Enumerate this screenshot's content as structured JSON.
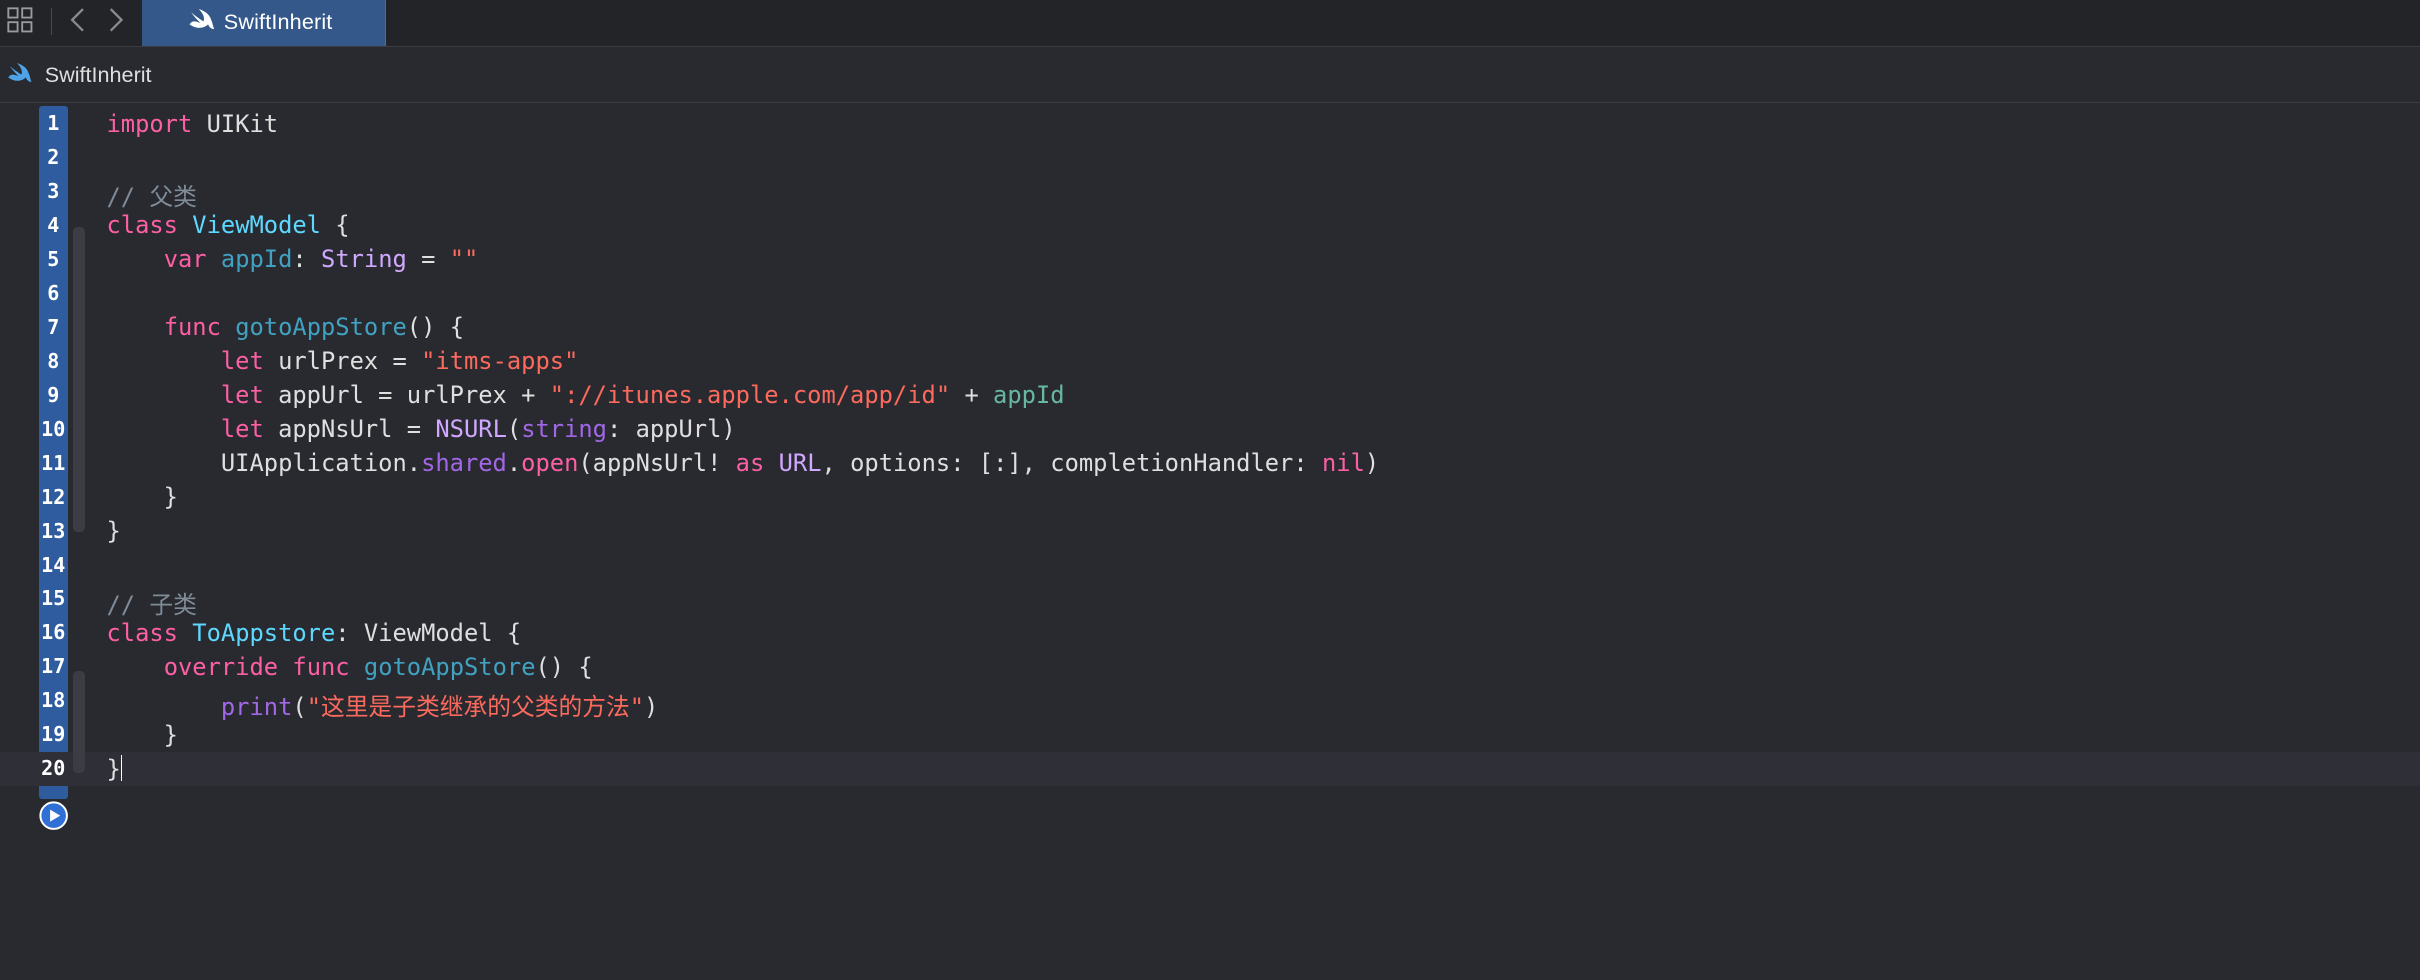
{
  "tabbar": {
    "active_tab": {
      "label": "SwiftInherit",
      "icon": "swift-icon"
    },
    "icons": {
      "grid": "grid-icon",
      "back": "chevron-left-icon",
      "forward": "chevron-right-icon"
    }
  },
  "breadcrumb": {
    "label": "SwiftInherit",
    "icon": "swift-icon"
  },
  "colors": {
    "keyword": "#fc5fa3",
    "comment": "#7f8c98",
    "string": "#fc6a5d",
    "type_decl": "#5dd8ff",
    "system_type": "#d0a8ff",
    "method_decl": "#41a1c0",
    "project_member": "#67b7a4",
    "system_member": "#a167e6",
    "plain": "#dfdfe0",
    "gutter": "#2e5c9e",
    "background": "#292a30"
  },
  "code": {
    "lines": [
      {
        "number": "1",
        "tokens": [
          {
            "t": "import",
            "c": "keyword"
          },
          {
            "t": " UIKit",
            "c": "plain"
          }
        ]
      },
      {
        "number": "2",
        "tokens": []
      },
      {
        "number": "3",
        "tokens": [
          {
            "t": "// 父类",
            "c": "comment"
          }
        ]
      },
      {
        "number": "4",
        "tokens": [
          {
            "t": "class",
            "c": "keyword"
          },
          {
            "t": " ",
            "c": "plain"
          },
          {
            "t": "ViewModel",
            "c": "type_decl"
          },
          {
            "t": " {",
            "c": "plain"
          }
        ]
      },
      {
        "number": "5",
        "tokens": [
          {
            "t": "    ",
            "c": "plain"
          },
          {
            "t": "var",
            "c": "keyword"
          },
          {
            "t": " ",
            "c": "plain"
          },
          {
            "t": "appId",
            "c": "method_decl"
          },
          {
            "t": ": ",
            "c": "plain"
          },
          {
            "t": "String",
            "c": "system_type"
          },
          {
            "t": " = ",
            "c": "plain"
          },
          {
            "t": "\"\"",
            "c": "string"
          }
        ]
      },
      {
        "number": "6",
        "tokens": []
      },
      {
        "number": "7",
        "tokens": [
          {
            "t": "    ",
            "c": "plain"
          },
          {
            "t": "func",
            "c": "keyword"
          },
          {
            "t": " ",
            "c": "plain"
          },
          {
            "t": "gotoAppStore",
            "c": "method_decl"
          },
          {
            "t": "() {",
            "c": "plain"
          }
        ]
      },
      {
        "number": "8",
        "tokens": [
          {
            "t": "        ",
            "c": "plain"
          },
          {
            "t": "let",
            "c": "keyword"
          },
          {
            "t": " urlPrex = ",
            "c": "plain"
          },
          {
            "t": "\"itms-apps\"",
            "c": "string"
          }
        ]
      },
      {
        "number": "9",
        "tokens": [
          {
            "t": "        ",
            "c": "plain"
          },
          {
            "t": "let",
            "c": "keyword"
          },
          {
            "t": " appUrl = urlPrex + ",
            "c": "plain"
          },
          {
            "t": "\"://itunes.apple.com/app/id\"",
            "c": "string"
          },
          {
            "t": " + ",
            "c": "plain"
          },
          {
            "t": "appId",
            "c": "project_member"
          }
        ]
      },
      {
        "number": "10",
        "tokens": [
          {
            "t": "        ",
            "c": "plain"
          },
          {
            "t": "let",
            "c": "keyword"
          },
          {
            "t": " appNsUrl = ",
            "c": "plain"
          },
          {
            "t": "NSURL",
            "c": "system_type"
          },
          {
            "t": "(",
            "c": "plain"
          },
          {
            "t": "string",
            "c": "system_member"
          },
          {
            "t": ": appUrl)",
            "c": "plain"
          }
        ]
      },
      {
        "number": "11",
        "tokens": [
          {
            "t": "        UIApplication.",
            "c": "plain"
          },
          {
            "t": "shared",
            "c": "system_member"
          },
          {
            "t": ".",
            "c": "plain"
          },
          {
            "t": "open",
            "c": "keyword"
          },
          {
            "t": "(appNsUrl! ",
            "c": "plain"
          },
          {
            "t": "as",
            "c": "keyword"
          },
          {
            "t": " ",
            "c": "plain"
          },
          {
            "t": "URL",
            "c": "system_type"
          },
          {
            "t": ", options: [:], completionHandler: ",
            "c": "plain"
          },
          {
            "t": "nil",
            "c": "keyword"
          },
          {
            "t": ")",
            "c": "plain"
          }
        ]
      },
      {
        "number": "12",
        "tokens": [
          {
            "t": "    }",
            "c": "plain"
          }
        ]
      },
      {
        "number": "13",
        "tokens": [
          {
            "t": "}",
            "c": "plain"
          }
        ]
      },
      {
        "number": "14",
        "tokens": []
      },
      {
        "number": "15",
        "tokens": [
          {
            "t": "// 子类",
            "c": "comment"
          }
        ]
      },
      {
        "number": "16",
        "tokens": [
          {
            "t": "class",
            "c": "keyword"
          },
          {
            "t": " ",
            "c": "plain"
          },
          {
            "t": "ToAppstore",
            "c": "type_decl"
          },
          {
            "t": ": ViewModel {",
            "c": "plain"
          }
        ]
      },
      {
        "number": "17",
        "tokens": [
          {
            "t": "    ",
            "c": "plain"
          },
          {
            "t": "override",
            "c": "keyword"
          },
          {
            "t": " ",
            "c": "plain"
          },
          {
            "t": "func",
            "c": "keyword"
          },
          {
            "t": " ",
            "c": "plain"
          },
          {
            "t": "gotoAppStore",
            "c": "method_decl"
          },
          {
            "t": "() {",
            "c": "plain"
          }
        ]
      },
      {
        "number": "18",
        "tokens": [
          {
            "t": "        ",
            "c": "plain"
          },
          {
            "t": "print",
            "c": "system_member"
          },
          {
            "t": "(",
            "c": "plain"
          },
          {
            "t": "\"这里是子类继承的父类的方法\"",
            "c": "string"
          },
          {
            "t": ")",
            "c": "plain"
          }
        ]
      },
      {
        "number": "19",
        "tokens": [
          {
            "t": "    }",
            "c": "plain"
          }
        ]
      },
      {
        "number": "20",
        "tokens": [
          {
            "t": "}",
            "c": "plain"
          }
        ],
        "current": true
      }
    ]
  },
  "run_button": {
    "icon": "play-icon"
  }
}
